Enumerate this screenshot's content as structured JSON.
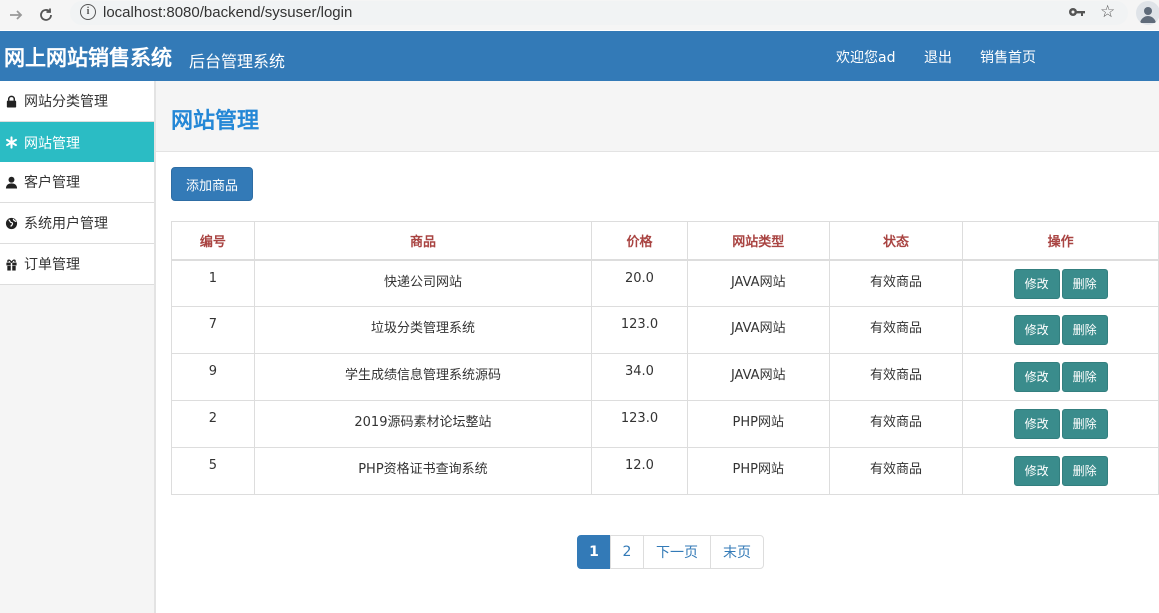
{
  "browser": {
    "url": "localhost:8080/backend/sysuser/login"
  },
  "header": {
    "brand": "网上网站销售系统",
    "subtitle": "后台管理系统",
    "welcome": "欢迎您ad",
    "logout": "退出",
    "home": "销售首页",
    "color": "#337ab7"
  },
  "sidebar": {
    "items": [
      {
        "label": "网站分类管理",
        "icon": "lock-icon"
      },
      {
        "label": "网站管理",
        "icon": "asterisk-icon",
        "active": true
      },
      {
        "label": "客户管理",
        "icon": "user-icon"
      },
      {
        "label": "系统用户管理",
        "icon": "globe-icon"
      },
      {
        "label": "订单管理",
        "icon": "gift-icon"
      }
    ],
    "active_color": "#2bbcc4"
  },
  "main": {
    "title": "网站管理",
    "add_button": "添加商品"
  },
  "table": {
    "headers": [
      "编号",
      "商品",
      "价格",
      "网站类型",
      "状态",
      "操作"
    ],
    "rows": [
      {
        "id": "1",
        "name": "快递公司网站",
        "price": "20.0",
        "type": "JAVA网站",
        "status": "有效商品"
      },
      {
        "id": "7",
        "name": "垃圾分类管理系统",
        "price": "123.0",
        "type": "JAVA网站",
        "status": "有效商品"
      },
      {
        "id": "9",
        "name": "学生成绩信息管理系统源码",
        "price": "34.0",
        "type": "JAVA网站",
        "status": "有效商品"
      },
      {
        "id": "2",
        "name": "2019源码素材论坛整站",
        "price": "123.0",
        "type": "PHP网站",
        "status": "有效商品"
      },
      {
        "id": "5",
        "name": "PHP资格证书查询系统",
        "price": "12.0",
        "type": "PHP网站",
        "status": "有效商品"
      }
    ],
    "edit_label": "修改",
    "delete_label": "删除"
  },
  "pagination": {
    "pages": [
      "1",
      "2"
    ],
    "current": "1",
    "next": "下一页",
    "last": "末页"
  }
}
